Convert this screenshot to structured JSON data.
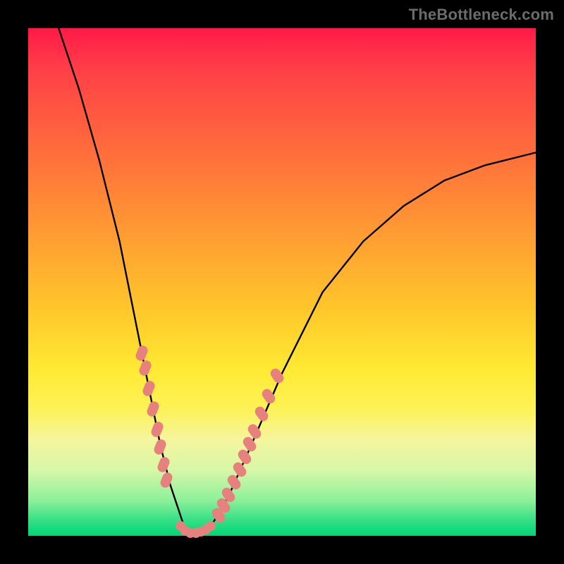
{
  "watermark": "TheBottleneck.com",
  "chart_data": {
    "type": "line",
    "title": "",
    "xlabel": "",
    "ylabel": "",
    "xlim": [
      0,
      100
    ],
    "ylim": [
      0,
      100
    ],
    "grid": false,
    "legend": false,
    "background_gradient": {
      "stops": [
        {
          "pos": 0.0,
          "color": "#ff1a48"
        },
        {
          "pos": 0.25,
          "color": "#ff6f3b"
        },
        {
          "pos": 0.55,
          "color": "#ffc62b"
        },
        {
          "pos": 0.8,
          "color": "#f5f59d"
        },
        {
          "pos": 1.0,
          "color": "#00d577"
        }
      ],
      "direction": "top-to-bottom"
    },
    "series": [
      {
        "name": "bottleneck-curve",
        "type": "line",
        "color": "#000000",
        "x": [
          6,
          10,
          14,
          18,
          22,
          24,
          26,
          28,
          30,
          31,
          32,
          33,
          34,
          36,
          38,
          40,
          44,
          50,
          58,
          66,
          74,
          82,
          90,
          98,
          100
        ],
        "y": [
          100,
          88,
          74,
          58,
          38,
          28,
          18,
          10,
          4,
          1,
          0,
          0,
          0.5,
          2,
          5,
          9,
          18,
          32,
          48,
          58,
          65,
          70,
          73,
          75,
          75.5
        ]
      },
      {
        "name": "highlight-dots-left",
        "type": "scatter",
        "color": "#e7817e",
        "x": [
          22.4,
          23.0,
          23.8,
          24.6,
          25.4,
          26.0,
          26.6,
          27.2
        ],
        "y": [
          36.0,
          33.0,
          29.0,
          25.0,
          21.0,
          17.5,
          14.0,
          11.0
        ]
      },
      {
        "name": "highlight-dots-bottom",
        "type": "scatter",
        "color": "#e7817e",
        "x": [
          30.0,
          31.0,
          32.0,
          33.0,
          34.0,
          35.0,
          36.0
        ],
        "y": [
          2.0,
          1.0,
          0.5,
          0.5,
          0.8,
          1.2,
          2.0
        ]
      },
      {
        "name": "highlight-dots-right",
        "type": "scatter",
        "color": "#e7817e",
        "x": [
          37.5,
          38.5,
          39.5,
          40.6,
          41.6,
          42.6,
          43.6,
          44.6,
          46.0,
          47.4,
          49.0
        ],
        "y": [
          4.0,
          6.0,
          8.0,
          10.5,
          13.0,
          15.5,
          18.0,
          20.5,
          24.0,
          27.5,
          31.5
        ]
      }
    ]
  }
}
